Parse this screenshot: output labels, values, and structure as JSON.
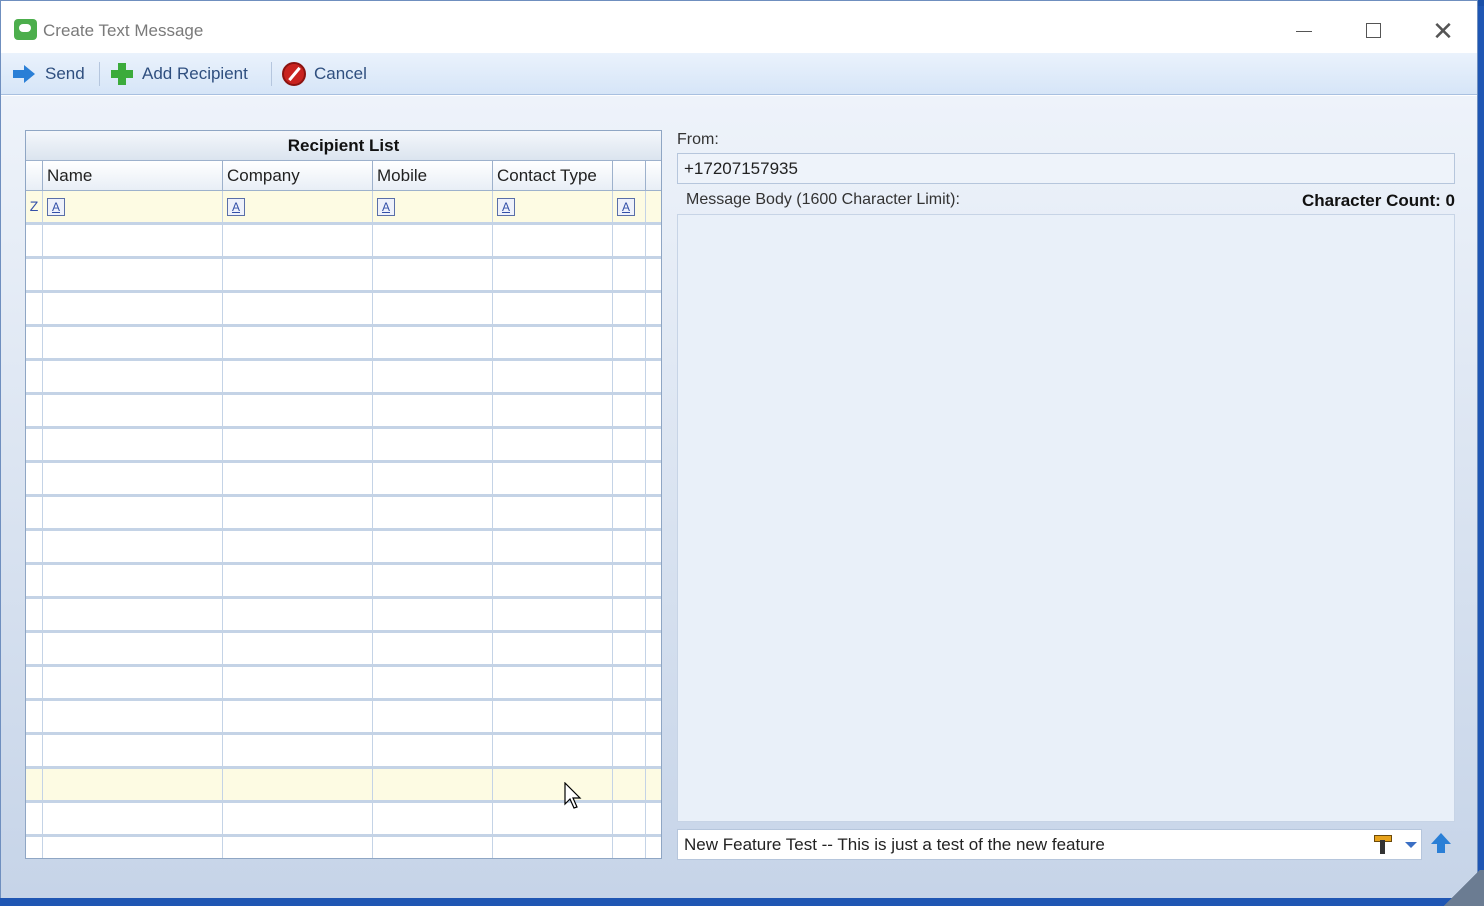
{
  "window": {
    "title": "Create Text Message",
    "minimize_glyph": "",
    "close_glyph": "✕"
  },
  "toolbar": {
    "send_label": "Send",
    "add_recipient_label": "Add Recipient",
    "cancel_label": "Cancel"
  },
  "recipient_list": {
    "caption": "Recipient List",
    "columns": [
      "Name",
      "Company",
      "Mobile",
      "Contact Type"
    ],
    "filter_icon_glyph": "A",
    "row_marker_glyph": "Z"
  },
  "message": {
    "from_label": "From:",
    "from_value": "+17207157935",
    "body_label": "Message Body (1600 Character Limit):",
    "char_count_label": "Character Count: 0",
    "body_text": "",
    "template_value": "New Feature Test -- This is just a test of the new feature"
  },
  "colors": {
    "accent": "#2a7fd6",
    "toolbar_bg": "#d6e5f7",
    "grid_highlight": "#fdfbe3",
    "cancel_red": "#c9231f",
    "add_green": "#3bab3b"
  }
}
